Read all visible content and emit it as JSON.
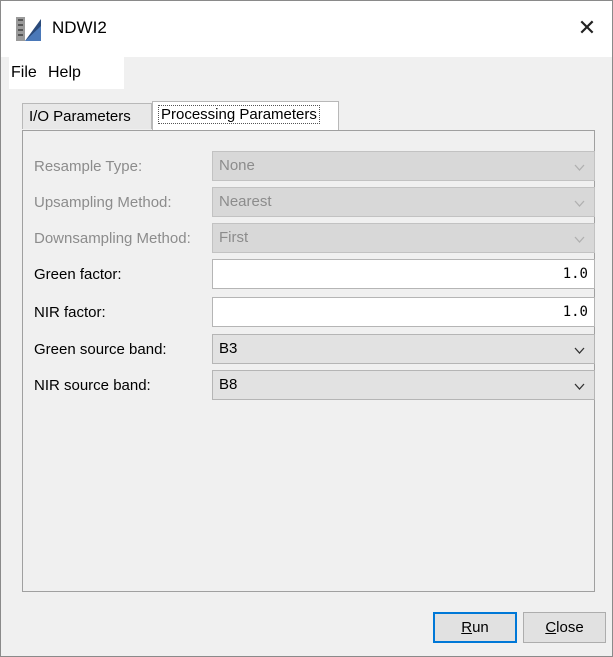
{
  "window": {
    "title": "NDWI2",
    "close_glyph": "✕",
    "icon": "app-icon"
  },
  "menu": {
    "file": "File",
    "help": "Help"
  },
  "tabs": [
    {
      "label": "I/O Parameters",
      "active": false
    },
    {
      "label": "Processing Parameters",
      "active": true
    }
  ],
  "params": {
    "resample_type": {
      "label": "Resample Type:",
      "value": "None",
      "enabled": false
    },
    "upsampling_method": {
      "label": "Upsampling Method:",
      "value": "Nearest",
      "enabled": false
    },
    "downsampling_method": {
      "label": "Downsampling Method:",
      "value": "First",
      "enabled": false
    },
    "green_factor": {
      "label": "Green factor:",
      "value": "1.0"
    },
    "nir_factor": {
      "label": "NIR factor:",
      "value": "1.0"
    },
    "green_source_band": {
      "label": "Green source band:",
      "value": "B3"
    },
    "nir_source_band": {
      "label": "NIR source band:",
      "value": "B8"
    }
  },
  "buttons": {
    "run_mnemonic": "R",
    "run_rest": "un",
    "close_mnemonic": "C",
    "close_rest": "lose"
  },
  "colors": {
    "accent": "#0078d7",
    "disabled_text": "#8c8c8c",
    "window_bg": "#f0f0f0"
  }
}
